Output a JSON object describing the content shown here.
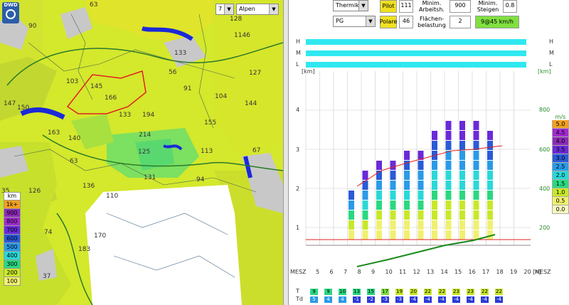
{
  "map": {
    "logo_text": "DWD",
    "day_select": "7",
    "region_select": "Alpen",
    "region_numbers": [
      {
        "label": "90"
      },
      {
        "label": "63"
      },
      {
        "label": "128"
      },
      {
        "label": "1146"
      },
      {
        "label": "133"
      },
      {
        "label": "127"
      },
      {
        "label": "56"
      },
      {
        "label": "103"
      },
      {
        "label": "145"
      },
      {
        "label": "166"
      },
      {
        "label": "91"
      },
      {
        "label": "104"
      },
      {
        "label": "144"
      },
      {
        "label": "147"
      },
      {
        "label": "150"
      },
      {
        "label": "133"
      },
      {
        "label": "194"
      },
      {
        "label": "155"
      },
      {
        "label": "163"
      },
      {
        "label": "140"
      },
      {
        "label": "214"
      },
      {
        "label": "125"
      },
      {
        "label": "113"
      },
      {
        "label": "67"
      },
      {
        "label": "63"
      },
      {
        "label": "136"
      },
      {
        "label": "131"
      },
      {
        "label": "94"
      },
      {
        "label": "35"
      },
      {
        "label": "126"
      },
      {
        "label": "110"
      },
      {
        "label": "74"
      },
      {
        "label": "170"
      },
      {
        "label": "183"
      },
      {
        "label": "37"
      }
    ],
    "legend_title": "km",
    "legend": [
      {
        "label": "1k+",
        "color": "#f0a020"
      },
      {
        "label": "900",
        "color": "#8c2ab8"
      },
      {
        "label": "800",
        "color": "#a02ad0"
      },
      {
        "label": "700",
        "color": "#6a2ad8"
      },
      {
        "label": "600",
        "color": "#2a5ad8"
      },
      {
        "label": "500",
        "color": "#2a9ae8"
      },
      {
        "label": "400",
        "color": "#2ad8d8"
      },
      {
        "label": "300",
        "color": "#2ad880"
      },
      {
        "label": "200",
        "color": "#c8e82a"
      },
      {
        "label": "100",
        "color": "#f0f070"
      }
    ]
  },
  "controls": {
    "mode_select": "Thermik",
    "glider_select": "PG",
    "pilot_label": "Pilot",
    "pilot_value": "111",
    "polare_label": "Polare",
    "polare_value": "46",
    "min_arbeitsh_label": "Minim. Arbeitsh.",
    "min_arbeitsh_value": "900",
    "flaechen_label": "Flächen- belastung",
    "flaechen_value": "2",
    "min_steigen_label": "Minim. Steigen",
    "min_steigen_value": "0.8",
    "result_label": "9@45 km/h"
  },
  "chart": {
    "cloud_layers": [
      "H",
      "M",
      "L"
    ],
    "left_unit": "[km]",
    "right_unit": "[km]",
    "left_ticks": [
      "4",
      "3",
      "2",
      "1"
    ],
    "right_ticks": [
      "800",
      "600",
      "400",
      "200"
    ],
    "x_label_left": "MESZ",
    "x_label_right": "MESZ",
    "hours": [
      "5",
      "6",
      "7",
      "8",
      "9",
      "10",
      "11",
      "12",
      "13",
      "14",
      "15",
      "16",
      "17",
      "18",
      "19",
      "20 [h]"
    ],
    "ms_title": "m/s",
    "ms_scale": [
      {
        "label": "5.0",
        "color": "#f0a020"
      },
      {
        "label": "4.5",
        "color": "#a02ad0"
      },
      {
        "label": "4.0",
        "color": "#8c2ab8"
      },
      {
        "label": "3.5",
        "color": "#6a2ad8"
      },
      {
        "label": "3.0",
        "color": "#2a5ad8"
      },
      {
        "label": "2.5",
        "color": "#2a9ae8"
      },
      {
        "label": "2.0",
        "color": "#2ad8d8"
      },
      {
        "label": "1.5",
        "color": "#2ad880"
      },
      {
        "label": "1.0",
        "color": "#c8e82a"
      },
      {
        "label": "0.5",
        "color": "#f0f070"
      },
      {
        "label": "0.0",
        "color": "#f8f8c0"
      }
    ],
    "t_label": "T",
    "td_label": "Td",
    "t_values": [
      "9",
      "9",
      "10",
      "13",
      "15",
      "17",
      "19",
      "20",
      "22",
      "22",
      "23",
      "23",
      "22",
      "22"
    ],
    "td_values": [
      "5",
      "4",
      "4",
      "-1",
      "-2",
      "-3",
      "-3",
      "-4",
      "-4",
      "-4",
      "-4",
      "-4",
      "-4",
      "-4"
    ]
  }
}
